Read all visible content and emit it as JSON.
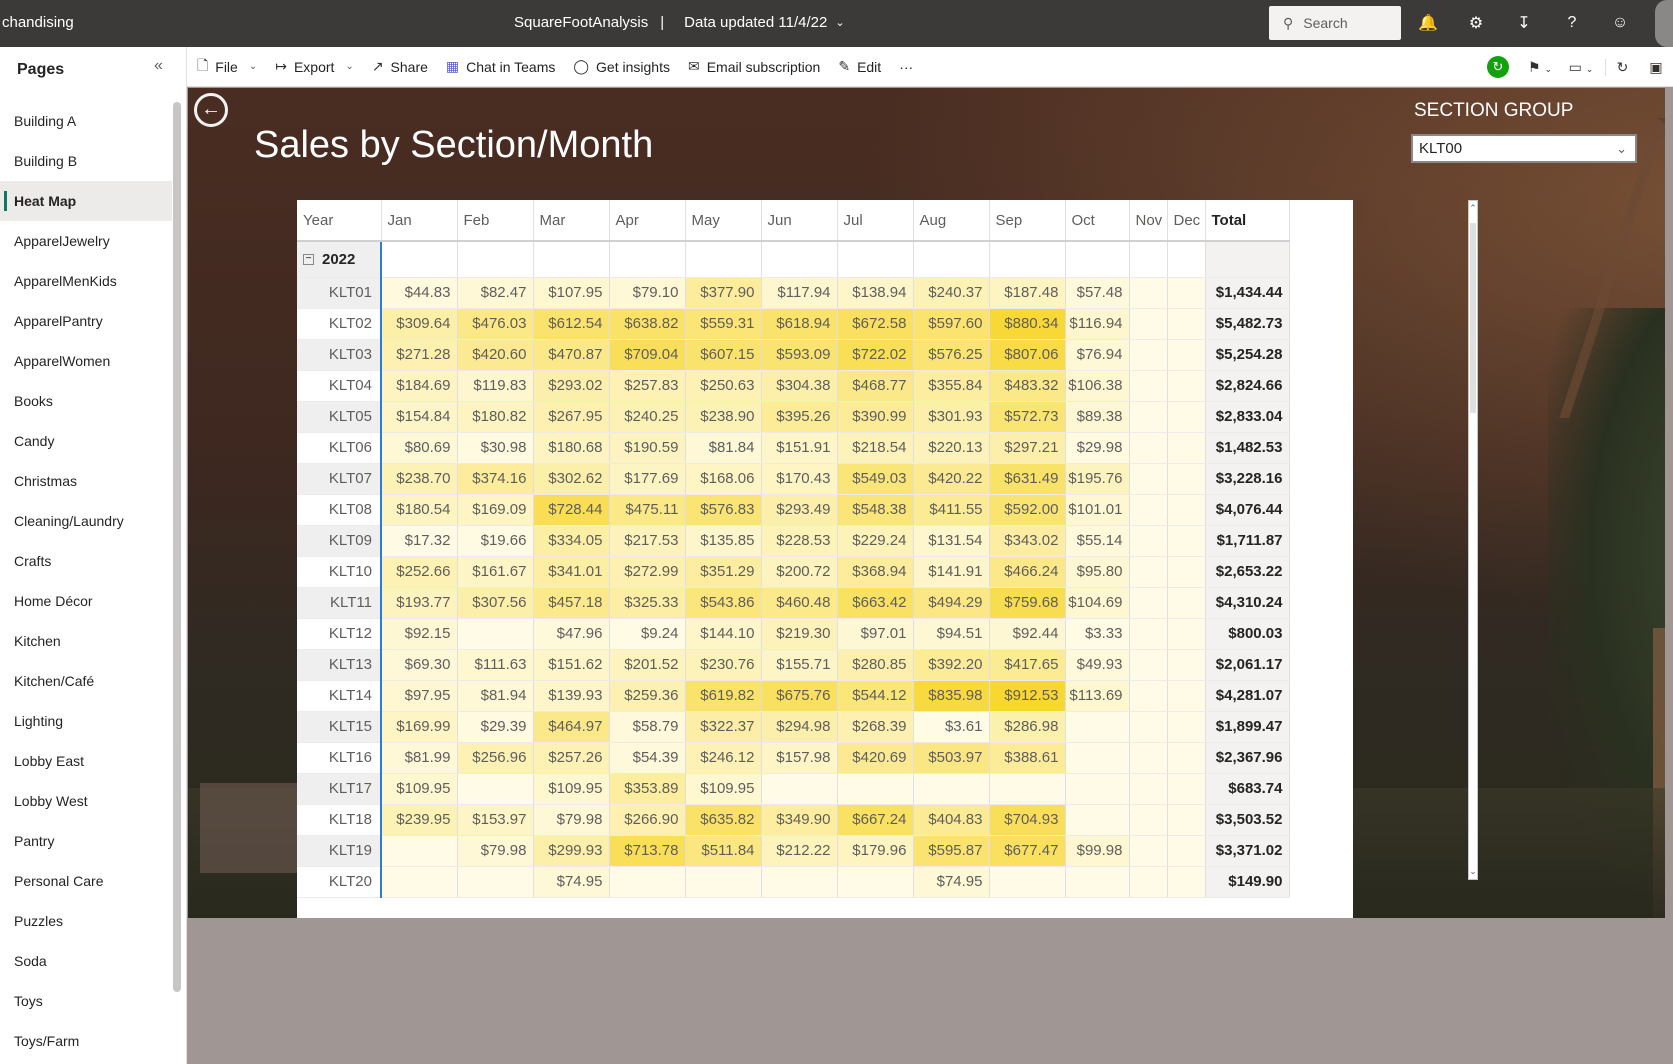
{
  "topbar": {
    "app_name": "chandising",
    "report_name": "SquareFootAnalysis",
    "separator": "|",
    "data_updated": "Data updated 11/4/22",
    "search_placeholder": "Search"
  },
  "pages_pane": {
    "title": "Pages",
    "items": [
      "Building A",
      "Building B",
      "Heat Map",
      "ApparelJewelry",
      "ApparelMenKids",
      "ApparelPantry",
      "ApparelWomen",
      "Books",
      "Candy",
      "Christmas",
      "Cleaning/Laundry",
      "Crafts",
      "Home Décor",
      "Kitchen",
      "Kitchen/Café",
      "Lighting",
      "Lobby East",
      "Lobby West",
      "Pantry",
      "Personal Care",
      "Puzzles",
      "Soda",
      "Toys",
      "Toys/Farm"
    ],
    "active_index": 2
  },
  "toolbar": {
    "file": "File",
    "export": "Export",
    "share": "Share",
    "chat_in_teams": "Chat in Teams",
    "get_insights": "Get insights",
    "email_subscription": "Email subscription",
    "edit": "Edit",
    "more": "···"
  },
  "report": {
    "title": "Sales by Section/Month",
    "slicer_label": "SECTION GROUP",
    "slicer_value": "KLT00"
  },
  "matrix": {
    "columns": [
      "Year",
      "Jan",
      "Feb",
      "Mar",
      "Apr",
      "May",
      "Jun",
      "Jul",
      "Aug",
      "Sep",
      "Oct",
      "Nov",
      "Dec",
      "Total"
    ],
    "year": "2022",
    "rows": [
      {
        "section": "KLT01",
        "values": [
          "$44.83",
          "$82.47",
          "$107.95",
          "$79.10",
          "$377.90",
          "$117.94",
          "$138.94",
          "$240.37",
          "$187.48",
          "$57.48",
          "",
          ""
        ],
        "total": "$1,434.44"
      },
      {
        "section": "KLT02",
        "values": [
          "$309.64",
          "$476.03",
          "$612.54",
          "$638.82",
          "$559.31",
          "$618.94",
          "$672.58",
          "$597.60",
          "$880.34",
          "$116.94",
          "",
          ""
        ],
        "total": "$5,482.73"
      },
      {
        "section": "KLT03",
        "values": [
          "$271.28",
          "$420.60",
          "$470.87",
          "$709.04",
          "$607.15",
          "$593.09",
          "$722.02",
          "$576.25",
          "$807.06",
          "$76.94",
          "",
          ""
        ],
        "total": "$5,254.28"
      },
      {
        "section": "KLT04",
        "values": [
          "$184.69",
          "$119.83",
          "$293.02",
          "$257.83",
          "$250.63",
          "$304.38",
          "$468.77",
          "$355.84",
          "$483.32",
          "$106.38",
          "",
          ""
        ],
        "total": "$2,824.66"
      },
      {
        "section": "KLT05",
        "values": [
          "$154.84",
          "$180.82",
          "$267.95",
          "$240.25",
          "$238.90",
          "$395.26",
          "$390.99",
          "$301.93",
          "$572.73",
          "$89.38",
          "",
          ""
        ],
        "total": "$2,833.04"
      },
      {
        "section": "KLT06",
        "values": [
          "$80.69",
          "$30.98",
          "$180.68",
          "$190.59",
          "$81.84",
          "$151.91",
          "$218.54",
          "$220.13",
          "$297.21",
          "$29.98",
          "",
          ""
        ],
        "total": "$1,482.53"
      },
      {
        "section": "KLT07",
        "values": [
          "$238.70",
          "$374.16",
          "$302.62",
          "$177.69",
          "$168.06",
          "$170.43",
          "$549.03",
          "$420.22",
          "$631.49",
          "$195.76",
          "",
          ""
        ],
        "total": "$3,228.16"
      },
      {
        "section": "KLT08",
        "values": [
          "$180.54",
          "$169.09",
          "$728.44",
          "$475.11",
          "$576.83",
          "$293.49",
          "$548.38",
          "$411.55",
          "$592.00",
          "$101.01",
          "",
          ""
        ],
        "total": "$4,076.44"
      },
      {
        "section": "KLT09",
        "values": [
          "$17.32",
          "$19.66",
          "$334.05",
          "$217.53",
          "$135.85",
          "$228.53",
          "$229.24",
          "$131.54",
          "$343.02",
          "$55.14",
          "",
          ""
        ],
        "total": "$1,711.87"
      },
      {
        "section": "KLT10",
        "values": [
          "$252.66",
          "$161.67",
          "$341.01",
          "$272.99",
          "$351.29",
          "$200.72",
          "$368.94",
          "$141.91",
          "$466.24",
          "$95.80",
          "",
          ""
        ],
        "total": "$2,653.22"
      },
      {
        "section": "KLT11",
        "values": [
          "$193.77",
          "$307.56",
          "$457.18",
          "$325.33",
          "$543.86",
          "$460.48",
          "$663.42",
          "$494.29",
          "$759.68",
          "$104.69",
          "",
          ""
        ],
        "total": "$4,310.24"
      },
      {
        "section": "KLT12",
        "values": [
          "$92.15",
          "",
          "$47.96",
          "$9.24",
          "$144.10",
          "$219.30",
          "$97.01",
          "$94.51",
          "$92.44",
          "$3.33",
          "",
          ""
        ],
        "total": "$800.03"
      },
      {
        "section": "KLT13",
        "values": [
          "$69.30",
          "$111.63",
          "$151.62",
          "$201.52",
          "$230.76",
          "$155.71",
          "$280.85",
          "$392.20",
          "$417.65",
          "$49.93",
          "",
          ""
        ],
        "total": "$2,061.17"
      },
      {
        "section": "KLT14",
        "values": [
          "$97.95",
          "$81.94",
          "$139.93",
          "$259.36",
          "$619.82",
          "$675.76",
          "$544.12",
          "$835.98",
          "$912.53",
          "$113.69",
          "",
          ""
        ],
        "total": "$4,281.07"
      },
      {
        "section": "KLT15",
        "values": [
          "$169.99",
          "$29.39",
          "$464.97",
          "$58.79",
          "$322.37",
          "$294.98",
          "$268.39",
          "$3.61",
          "$286.98",
          "",
          "",
          ""
        ],
        "total": "$1,899.47"
      },
      {
        "section": "KLT16",
        "values": [
          "$81.99",
          "$256.96",
          "$257.26",
          "$54.39",
          "$246.12",
          "$157.98",
          "$420.69",
          "$503.97",
          "$388.61",
          "",
          "",
          ""
        ],
        "total": "$2,367.96"
      },
      {
        "section": "KLT17",
        "values": [
          "$109.95",
          "",
          "$109.95",
          "$353.89",
          "$109.95",
          "",
          "",
          "",
          "",
          "",
          "",
          ""
        ],
        "total": "$683.74"
      },
      {
        "section": "KLT18",
        "values": [
          "$239.95",
          "$153.97",
          "$79.98",
          "$266.90",
          "$635.82",
          "$349.90",
          "$667.24",
          "$404.83",
          "$704.93",
          "",
          "",
          ""
        ],
        "total": "$3,503.52"
      },
      {
        "section": "KLT19",
        "values": [
          "",
          "$79.98",
          "$299.93",
          "$713.78",
          "$511.84",
          "$212.22",
          "$179.96",
          "$595.87",
          "$677.47",
          "$99.98",
          "",
          ""
        ],
        "total": "$3,371.02"
      },
      {
        "section": "KLT20",
        "values": [
          "",
          "",
          "$74.95",
          "",
          "",
          "",
          "",
          "$74.95",
          "",
          "",
          "",
          ""
        ],
        "total": "$149.90"
      }
    ],
    "heat_colors": {
      "low": "#fffbe6",
      "high": "#f7d730"
    }
  }
}
